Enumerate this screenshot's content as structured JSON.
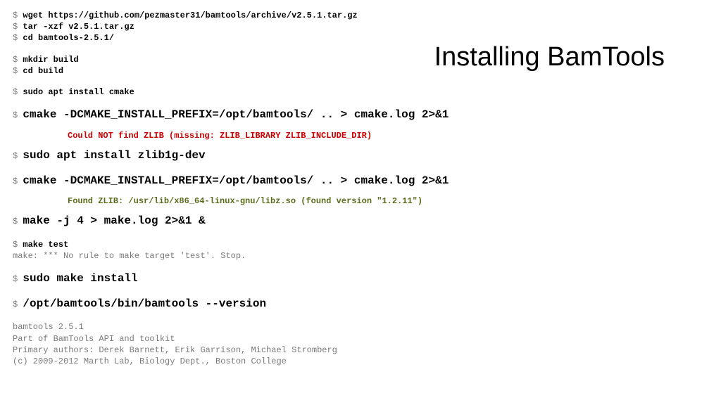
{
  "title": "Installing BamTools",
  "lines": {
    "wget": "wget https://github.com/pezmaster31/bamtools/archive/v2.5.1.tar.gz",
    "tar": "tar -xzf v2.5.1.tar.gz",
    "cd1": "cd bamtools-2.5.1/",
    "mkdir": "mkdir build",
    "cd2": "cd build",
    "apt1": "sudo apt install cmake",
    "cmake1": "cmake -DCMAKE_INSTALL_PREFIX=/opt/bamtools/ .. > cmake.log 2>&1",
    "err": "Could NOT find ZLIB (missing: ZLIB_LIBRARY ZLIB_INCLUDE_DIR)",
    "apt2": "sudo apt install zlib1g-dev",
    "cmake2": "cmake -DCMAKE_INSTALL_PREFIX=/opt/bamtools/ .. > cmake.log 2>&1",
    "ok": "Found ZLIB: /usr/lib/x86_64-linux-gnu/libz.so (found version \"1.2.11\")",
    "make": "make -j 4 > make.log 2>&1 &",
    "mtest": "make test",
    "mtesto": "make: *** No rule to make target 'test'. Stop.",
    "inst": "sudo make install",
    "ver": "/opt/bamtools/bin/bamtools --version",
    "o1": "bamtools 2.5.1",
    "o2": "Part of BamTools API and toolkit",
    "o3": "Primary authors: Derek Barnett, Erik Garrison, Michael Stromberg",
    "o4": "(c) 2009-2012 Marth Lab, Biology Dept., Boston College"
  },
  "prompt": "$ "
}
